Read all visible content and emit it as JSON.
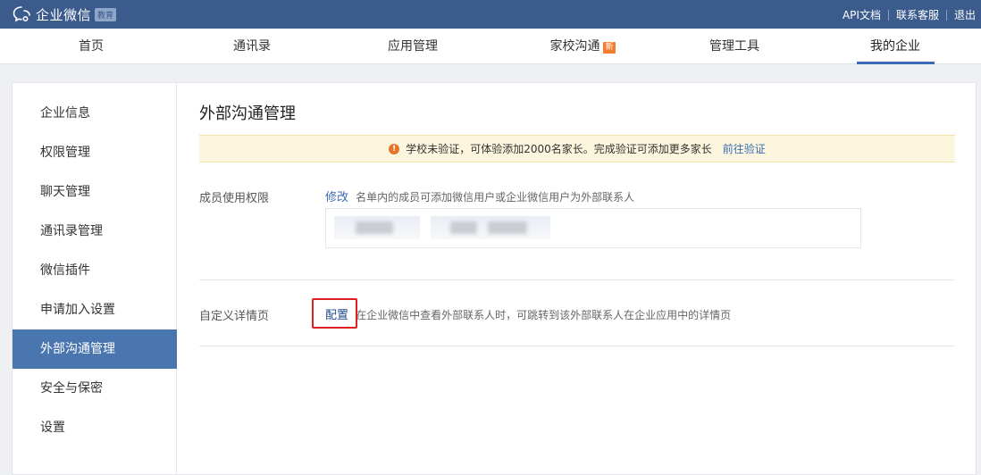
{
  "topbar": {
    "brand": "企业微信",
    "badge": "教育",
    "links": [
      "API文档",
      "联系客服",
      "退出"
    ]
  },
  "nav": {
    "items": [
      {
        "label": "首页"
      },
      {
        "label": "通讯录"
      },
      {
        "label": "应用管理"
      },
      {
        "label": "家校沟通",
        "badge": "新"
      },
      {
        "label": "管理工具"
      },
      {
        "label": "我的企业",
        "active": true
      }
    ]
  },
  "sidebar": {
    "items": [
      {
        "label": "企业信息"
      },
      {
        "label": "权限管理"
      },
      {
        "label": "聊天管理"
      },
      {
        "label": "通讯录管理"
      },
      {
        "label": "微信插件"
      },
      {
        "label": "申请加入设置"
      },
      {
        "label": "外部沟通管理",
        "active": true
      },
      {
        "label": "安全与保密"
      },
      {
        "label": "设置"
      }
    ]
  },
  "main": {
    "title": "外部沟通管理",
    "notice": {
      "text": "学校未验证，可体验添加2000名家长。完成验证可添加更多家长",
      "link": "前往验证",
      "icon": "info-icon"
    },
    "member_permission": {
      "label": "成员使用权限",
      "action": "修改",
      "description": "名单内的成员可添加微信用户或企业微信用户为外部联系人"
    },
    "custom_detail": {
      "label": "自定义详情页",
      "action": "配置",
      "description": "在企业微信中查看外部联系人时，可跳转到该外部联系人在企业应用中的详情页"
    }
  },
  "colors": {
    "topbar": "#3b5b8d",
    "accent": "#3b6cb3",
    "sidebar_active": "#4a76b0",
    "notice_bg": "#fbf6dd",
    "highlight": "#e02020",
    "new_badge": "#f47c2c"
  }
}
